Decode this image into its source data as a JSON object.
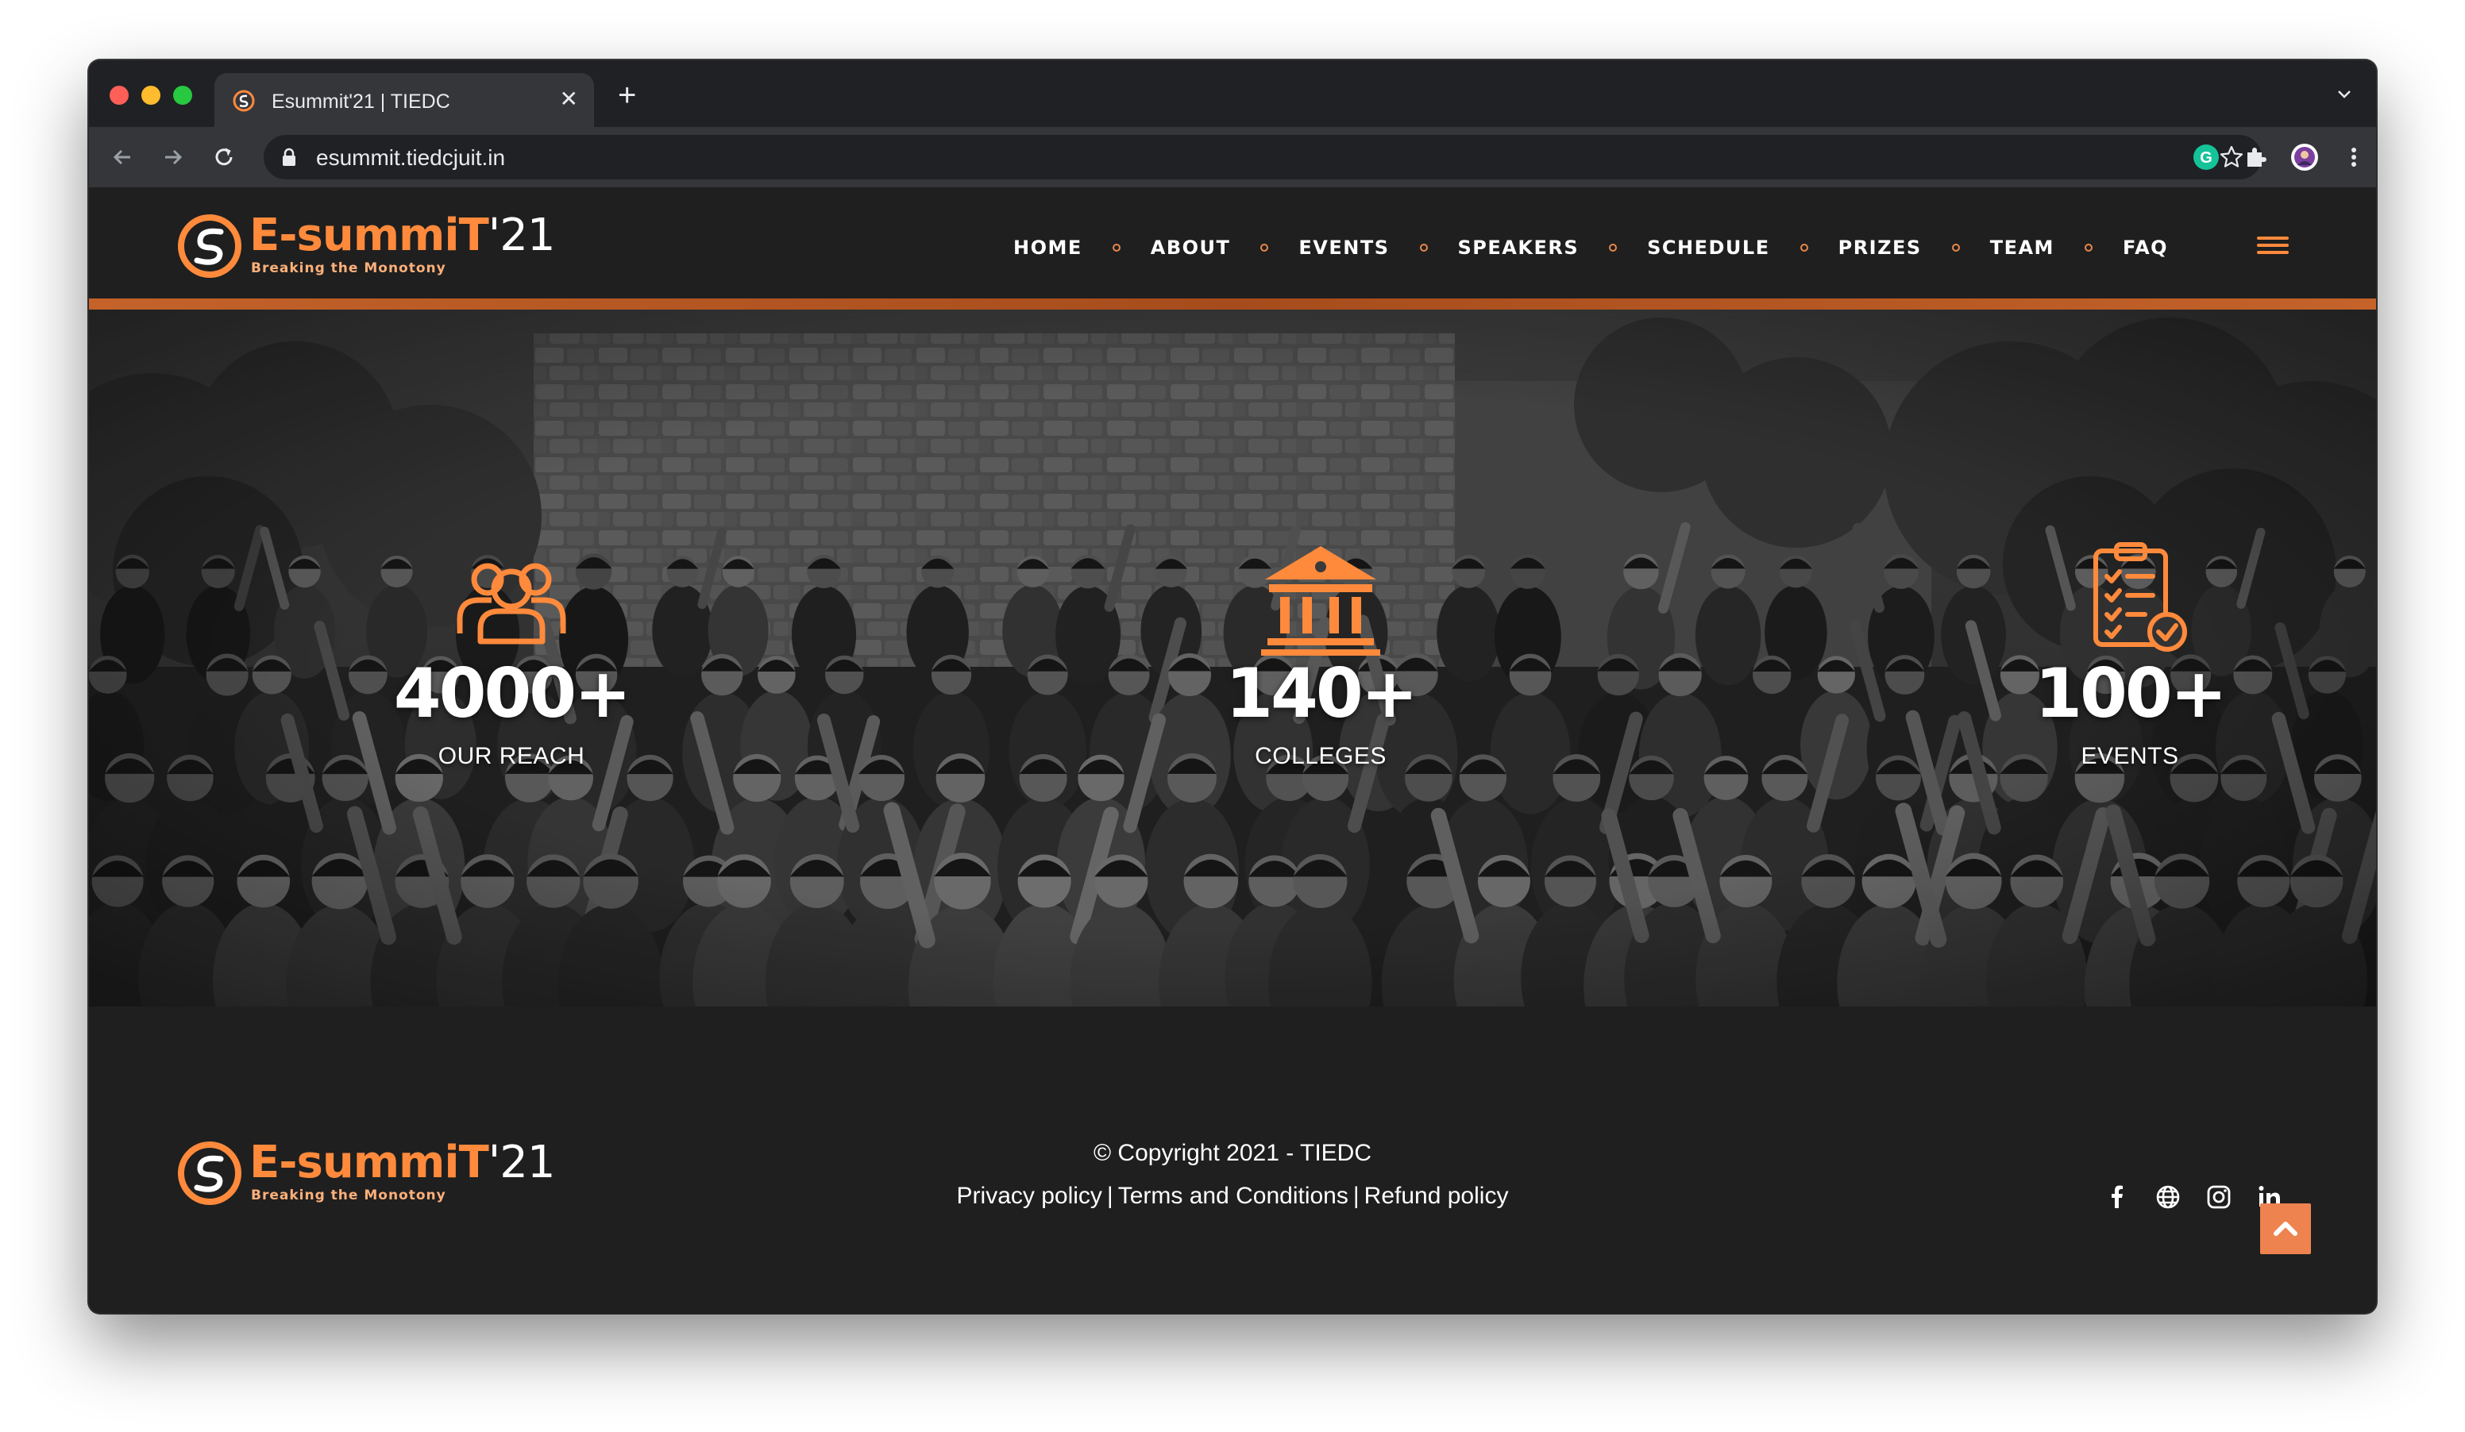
{
  "browser": {
    "tab_title": "Esummit'21 | TIEDC",
    "url": "esummit.tiedcjuit.in"
  },
  "site": {
    "logo": {
      "brand": "E-summiT",
      "year": "'21",
      "tagline": "Breaking the Monotony"
    },
    "nav": {
      "items": [
        {
          "label": "HOME"
        },
        {
          "label": "ABOUT"
        },
        {
          "label": "EVENTS"
        },
        {
          "label": "SPEAKERS"
        },
        {
          "label": "SCHEDULE"
        },
        {
          "label": "PRIZES"
        },
        {
          "label": "TEAM"
        },
        {
          "label": "FAQ"
        }
      ]
    },
    "stats": [
      {
        "icon": "people-group-icon",
        "value": "4000+",
        "label": "OUR REACH"
      },
      {
        "icon": "college-building-icon",
        "value": "140+",
        "label": "COLLEGES"
      },
      {
        "icon": "checklist-clipboard-icon",
        "value": "100+",
        "label": "EVENTS"
      }
    ],
    "footer": {
      "copyright": "© Copyright 2021 - TIEDC",
      "links": [
        "Privacy policy",
        "Terms and Conditions",
        "Refund policy"
      ],
      "socials": [
        "facebook-icon",
        "globe-icon",
        "instagram-icon",
        "linkedin-icon"
      ]
    }
  },
  "colors": {
    "accent": "#ff8a3c",
    "background": "#1f1f1f",
    "browser_chrome": "#202124"
  }
}
